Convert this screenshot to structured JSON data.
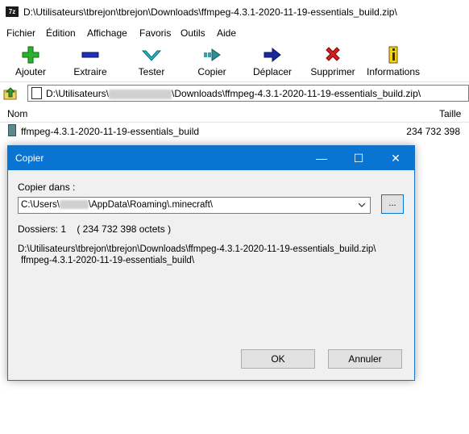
{
  "window": {
    "app_icon_text": "7z",
    "title": "D:\\Utilisateurs\\tbrejon\\tbrejon\\Downloads\\ffmpeg-4.3.1-2020-11-19-essentials_build.zip\\"
  },
  "menu": [
    "Fichier",
    "Édition",
    "Affichage",
    "Favoris",
    "Outils",
    "Aide"
  ],
  "toolbar": {
    "add": "Ajouter",
    "extract": "Extraire",
    "test": "Tester",
    "copy": "Copier",
    "move": "Déplacer",
    "delete": "Supprimer",
    "info": "Informations"
  },
  "address": {
    "prefix": "D:\\Utilisateurs\\",
    "suffix": "\\Downloads\\ffmpeg-4.3.1-2020-11-19-essentials_build.zip\\"
  },
  "list": {
    "col_name": "Nom",
    "col_size": "Taille",
    "rows": [
      {
        "name": "ffmpeg-4.3.1-2020-11-19-essentials_build",
        "size": "234 732 398"
      }
    ]
  },
  "dialog": {
    "title": "Copier",
    "copy_to_label": "Copier dans :",
    "dest_prefix": "C:\\Users\\",
    "dest_suffix": "\\AppData\\Roaming\\.minecraft\\",
    "browse": "...",
    "folders_info": "Dossiers: 1    ( 234 732 398 octets )",
    "path_line1": "D:\\Utilisateurs\\tbrejon\\tbrejon\\Downloads\\ffmpeg-4.3.1-2020-11-19-essentials_build.zip\\",
    "path_line2": "ffmpeg-4.3.1-2020-11-19-essentials_build\\",
    "ok": "OK",
    "cancel": "Annuler"
  },
  "colors": {
    "dialog_titlebar": "#0a74d3",
    "add_icon": "#2db12d",
    "delete_icon": "#d11f1f",
    "info_icon": "#f3d21b"
  }
}
